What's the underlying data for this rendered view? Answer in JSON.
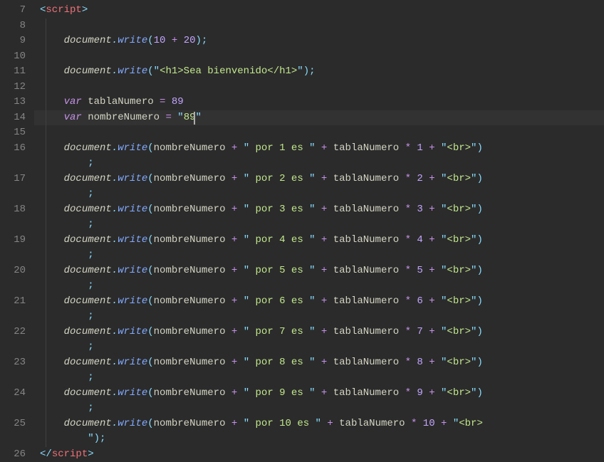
{
  "editor": {
    "language": "javascript-html",
    "highlighted_line": 14,
    "lines": [
      {
        "n": 7,
        "wraps": 0,
        "tokens": [
          {
            "t": "<",
            "c": "c-angle"
          },
          {
            "t": "script",
            "c": "c-tag"
          },
          {
            "t": ">",
            "c": "c-angle"
          }
        ]
      },
      {
        "n": 8,
        "wraps": 0,
        "tokens": []
      },
      {
        "n": 9,
        "wraps": 0,
        "indent": "    ",
        "tokens": [
          {
            "t": "document",
            "c": "c-obj"
          },
          {
            "t": ".",
            "c": "c-dot"
          },
          {
            "t": "write",
            "c": "c-func"
          },
          {
            "t": "(",
            "c": "c-punc"
          },
          {
            "t": "10",
            "c": "c-num"
          },
          {
            "t": " + ",
            "c": "c-op"
          },
          {
            "t": "20",
            "c": "c-num"
          },
          {
            "t": ")",
            "c": "c-punc"
          },
          {
            "t": ";",
            "c": "c-punc"
          }
        ]
      },
      {
        "n": 10,
        "wraps": 0,
        "tokens": []
      },
      {
        "n": 11,
        "wraps": 0,
        "indent": "    ",
        "tokens": [
          {
            "t": "document",
            "c": "c-obj"
          },
          {
            "t": ".",
            "c": "c-dot"
          },
          {
            "t": "write",
            "c": "c-func"
          },
          {
            "t": "(",
            "c": "c-punc"
          },
          {
            "t": "\"",
            "c": "c-quote"
          },
          {
            "t": "<h1>Sea bienvenido</h1>",
            "c": "c-str"
          },
          {
            "t": "\"",
            "c": "c-quote"
          },
          {
            "t": ")",
            "c": "c-punc"
          },
          {
            "t": ";",
            "c": "c-punc"
          }
        ]
      },
      {
        "n": 12,
        "wraps": 0,
        "tokens": []
      },
      {
        "n": 13,
        "wraps": 0,
        "indent": "    ",
        "tokens": [
          {
            "t": "var",
            "c": "c-kw"
          },
          {
            "t": " ",
            "c": ""
          },
          {
            "t": "tablaNumero",
            "c": "c-var"
          },
          {
            "t": " = ",
            "c": "c-op"
          },
          {
            "t": "89",
            "c": "c-num"
          }
        ]
      },
      {
        "n": 14,
        "wraps": 0,
        "indent": "    ",
        "highlighted": true,
        "cursor_after_token": 6,
        "tokens": [
          {
            "t": "var",
            "c": "c-kw"
          },
          {
            "t": " ",
            "c": ""
          },
          {
            "t": "nombreNumero",
            "c": "c-var"
          },
          {
            "t": " = ",
            "c": "c-op"
          },
          {
            "t": "\"",
            "c": "c-quote"
          },
          {
            "t": "89",
            "c": "c-str"
          },
          {
            "t": "\"",
            "c": "c-quote"
          }
        ]
      },
      {
        "n": 15,
        "wraps": 0,
        "tokens": []
      },
      {
        "n": 16,
        "wraps": 1,
        "mult": 1
      },
      {
        "n": 17,
        "wraps": 1,
        "mult": 2
      },
      {
        "n": 18,
        "wraps": 1,
        "mult": 3
      },
      {
        "n": 19,
        "wraps": 1,
        "mult": 4
      },
      {
        "n": 20,
        "wraps": 1,
        "mult": 5
      },
      {
        "n": 21,
        "wraps": 1,
        "mult": 6
      },
      {
        "n": 22,
        "wraps": 1,
        "mult": 7
      },
      {
        "n": 23,
        "wraps": 1,
        "mult": 8
      },
      {
        "n": 24,
        "wraps": 1,
        "mult": 9
      },
      {
        "n": 25,
        "wraps": 1,
        "mult": 10,
        "last": true
      },
      {
        "n": 26,
        "wraps": 0,
        "tokens": [
          {
            "t": "</",
            "c": "c-angle"
          },
          {
            "t": "script",
            "c": "c-tag"
          },
          {
            "t": ">",
            "c": "c-angle"
          }
        ]
      }
    ],
    "mult_template": {
      "prefix_indent": "    ",
      "por_text_pre": " por ",
      "por_text_post": " es ",
      "br_text": "<br>",
      "wrap_indent": "        ",
      "last_wrap_content": "\");",
      "normal_wrap_content": ";"
    }
  }
}
